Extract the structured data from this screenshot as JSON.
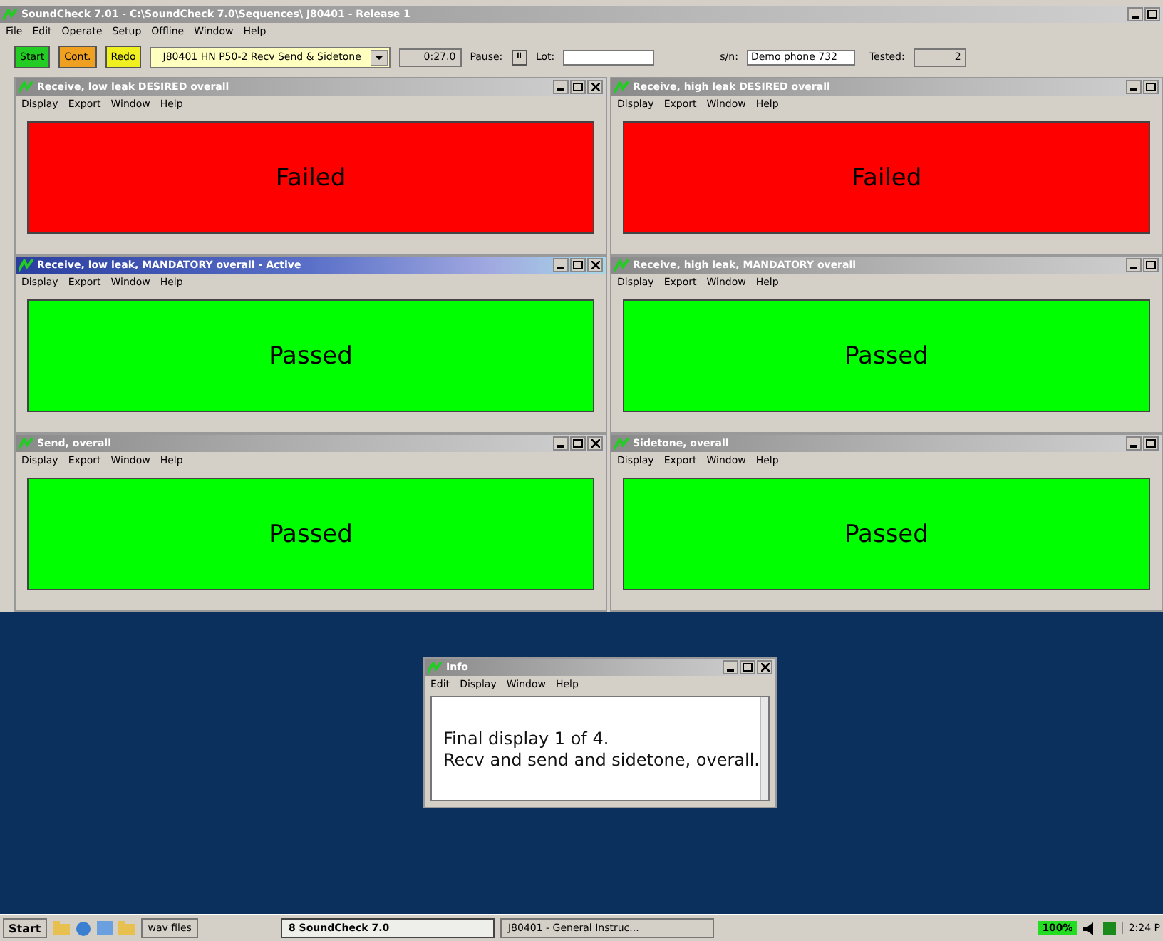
{
  "window": {
    "title": "SoundCheck 7.01 - C:\\SoundCheck 7.0\\Sequences\\ J80401 - Release 1"
  },
  "menu": [
    "File",
    "Edit",
    "Operate",
    "Setup",
    "Offline",
    "Window",
    "Help"
  ],
  "toolbar": {
    "buttons": [
      {
        "label": "Start",
        "kind": "start"
      },
      {
        "label": "Cont.",
        "kind": "continue"
      },
      {
        "label": "Redo",
        "kind": "redo"
      }
    ],
    "sequence": "J80401 HN P50-2 Recv Send & Sidetone",
    "time": "0:27.0",
    "pause_label": "Pause:",
    "pause_button": "II",
    "lot_label": "Lot:",
    "sn_label": "s/n:",
    "sn_value": "Demo phone 732",
    "tested_label": "Tested:",
    "tested_value": "2"
  },
  "panels": [
    {
      "title": "Receive, low leak DESIRED overall",
      "active": false,
      "menu": [
        "Display",
        "Export",
        "Window",
        "Help"
      ],
      "result": "Failed",
      "kind": "failed"
    },
    {
      "title": "Receive, high leak DESIRED overall",
      "active": false,
      "menu": [
        "Display",
        "Export",
        "Window",
        "Help"
      ],
      "result": "Failed",
      "kind": "failed"
    },
    {
      "title": "Receive, low leak, MANDATORY overall - Active",
      "active": true,
      "menu": [
        "Display",
        "Export",
        "Window",
        "Help"
      ],
      "result": "Passed",
      "kind": "passed"
    },
    {
      "title": "Receive, high leak, MANDATORY overall",
      "active": false,
      "menu": [
        "Display",
        "Export",
        "Window",
        "Help"
      ],
      "result": "Passed",
      "kind": "passed"
    },
    {
      "title": "Send, overall",
      "active": false,
      "menu": [
        "Display",
        "Export",
        "Window",
        "Help"
      ],
      "result": "Passed",
      "kind": "passed"
    },
    {
      "title": "Sidetone, overall",
      "active": false,
      "menu": [
        "Display",
        "Export",
        "Window",
        "Help"
      ],
      "result": "Passed",
      "kind": "passed"
    }
  ],
  "info": {
    "title": "Info",
    "menu": [
      "Edit",
      "Display",
      "Window",
      "Help"
    ],
    "lines": [
      "Final display 1 of 4.",
      "Recv and send and sidetone, overall."
    ]
  },
  "taskbar": {
    "start": "Start",
    "folder": "wav files",
    "tasks": [
      {
        "label": "8 SoundCheck 7.0",
        "selected": true
      },
      {
        "label": "J80401 - General Instruc...",
        "selected": false
      }
    ],
    "zoom": "100%",
    "clock": "2:24 P"
  }
}
